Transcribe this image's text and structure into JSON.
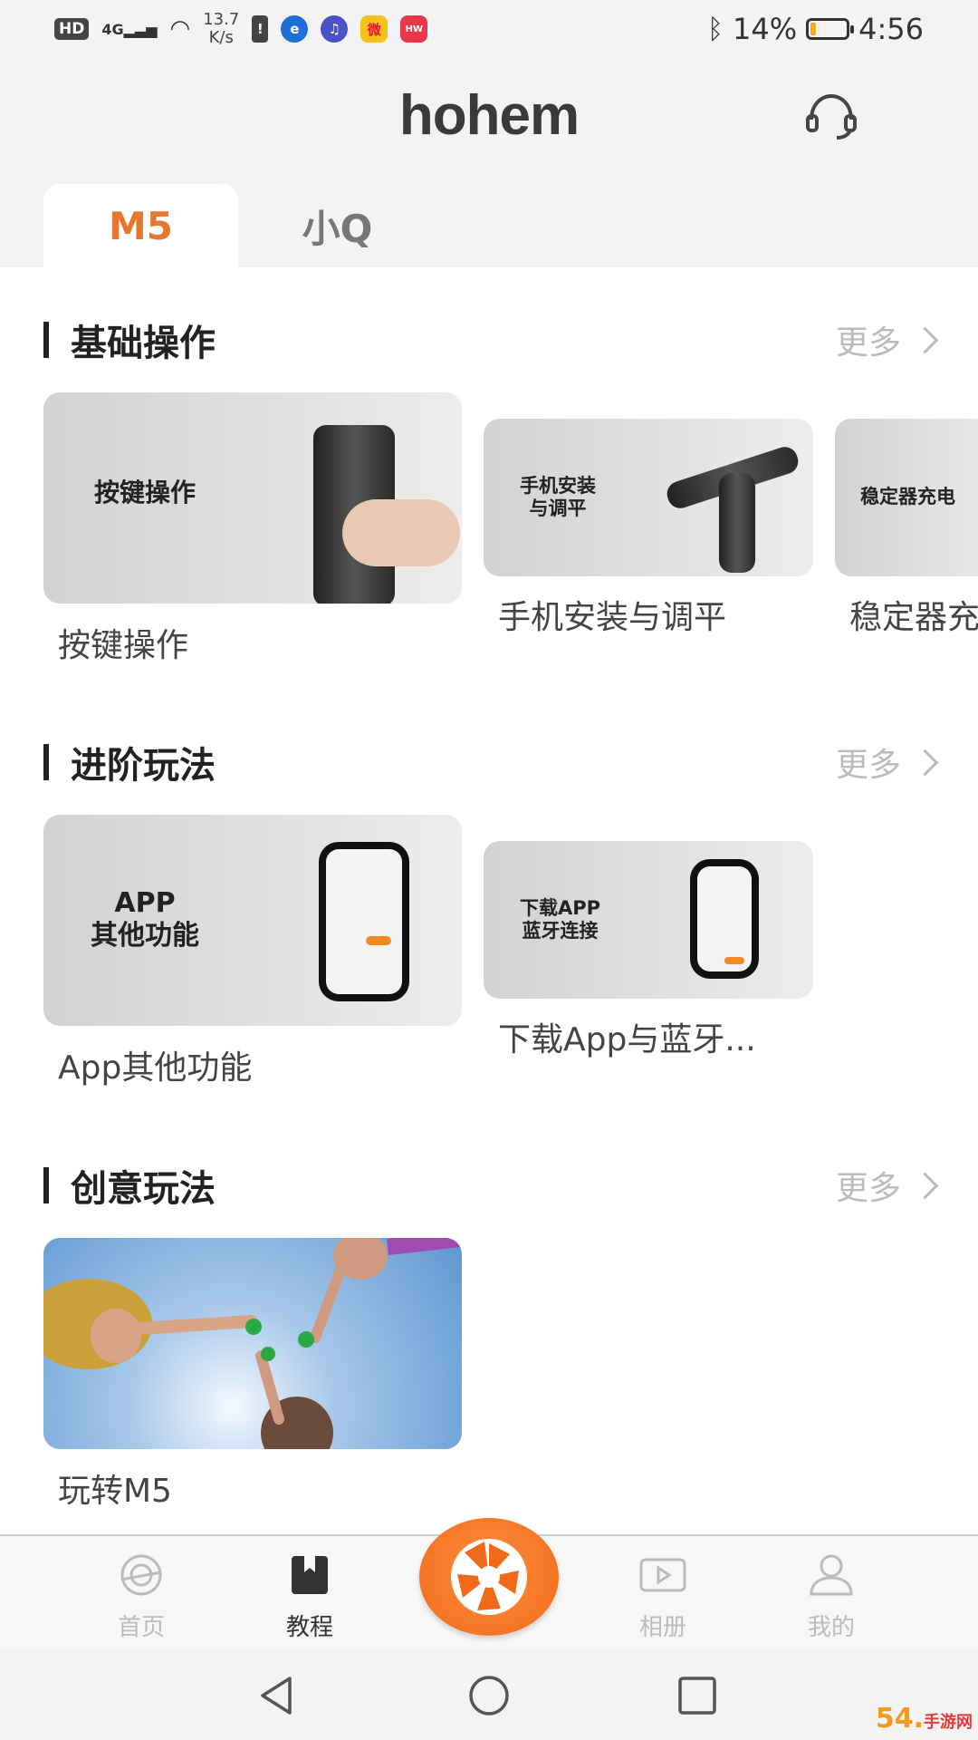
{
  "status_bar": {
    "hd": "HD",
    "network": "4G",
    "speed_value": "13.7",
    "speed_unit": "K/s",
    "battery": "14%",
    "battery_level": 0.14,
    "time": "4:56",
    "app_icons": [
      {
        "name": "alert-icon",
        "glyph": "!",
        "color": "#444444"
      },
      {
        "name": "browser-icon",
        "glyph": "e",
        "color": "#1e6fd9"
      },
      {
        "name": "music-icon",
        "glyph": "♫",
        "color": "#4a52c8"
      },
      {
        "name": "weibo-icon",
        "glyph": "微",
        "color": "#e6162d"
      },
      {
        "name": "huawei-store-icon",
        "glyph": "HW",
        "color": "#e8364a"
      }
    ]
  },
  "header": {
    "logo": "hohem",
    "support_icon": "headset-icon"
  },
  "tabs": [
    {
      "label": "M5",
      "active": true
    },
    {
      "label": "小Q",
      "active": false
    }
  ],
  "colors": {
    "accent": "#e8772e",
    "inactive_text": "#bbbbbb"
  },
  "sections": [
    {
      "title": "基础操作",
      "more": "更多",
      "cards": [
        {
          "thumb_text": "按键操作",
          "caption": "按键操作"
        },
        {
          "thumb_text_1": "手机安装",
          "thumb_text_2": "与调平",
          "caption": "手机安装与调平"
        },
        {
          "thumb_text": "稳定器充电",
          "caption": "稳定器充"
        }
      ]
    },
    {
      "title": "进阶玩法",
      "more": "更多",
      "cards": [
        {
          "thumb_text_1": "APP",
          "thumb_text_2": "其他功能",
          "caption": "App其他功能"
        },
        {
          "thumb_text_1": "下载APP",
          "thumb_text_2": "蓝牙连接",
          "caption": "下载App与蓝牙..."
        }
      ]
    },
    {
      "title": "创意玩法",
      "more": "更多",
      "cards": [
        {
          "caption": "玩转M5"
        }
      ]
    }
  ],
  "bottom_nav": [
    {
      "label": "首页",
      "icon": "home-icon",
      "active": false
    },
    {
      "label": "教程",
      "icon": "book-icon",
      "active": true
    },
    {
      "label": "",
      "icon": "camera-shutter-icon",
      "active": false
    },
    {
      "label": "相册",
      "icon": "album-icon",
      "active": false
    },
    {
      "label": "我的",
      "icon": "profile-icon",
      "active": false
    }
  ],
  "watermark": {
    "text": "54.",
    "sub": "手游网"
  }
}
